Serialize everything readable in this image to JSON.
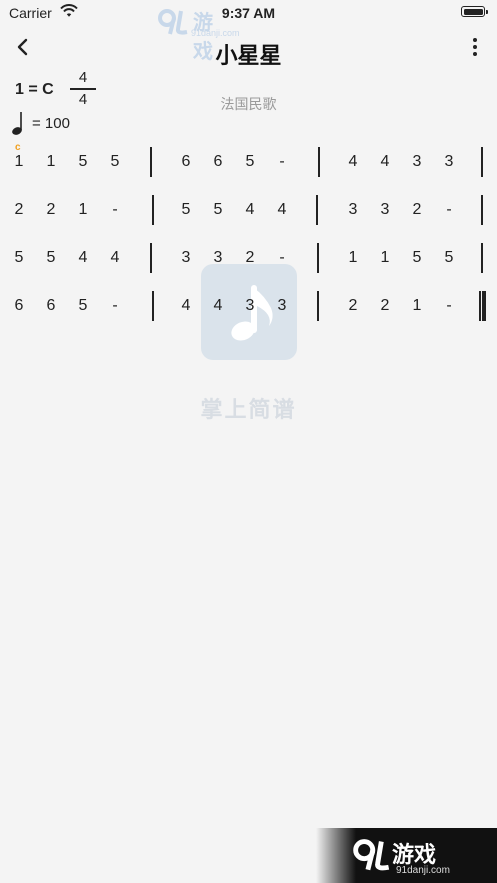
{
  "status_bar": {
    "carrier": "Carrier",
    "time": "9:37 AM"
  },
  "header": {
    "title": "小星星"
  },
  "song": {
    "key": "1 = C",
    "time_signature": {
      "top": "4",
      "bottom": "4"
    },
    "composer": "法国民歌",
    "tempo": "= 100",
    "chord_marker": "c"
  },
  "score": {
    "rows": [
      {
        "measures": [
          [
            "1",
            "1",
            "5",
            "5"
          ],
          [
            "6",
            "6",
            "5",
            "-"
          ],
          [
            "4",
            "4",
            "3",
            "3"
          ]
        ],
        "final": false
      },
      {
        "measures": [
          [
            "2",
            "2",
            "1",
            "-"
          ],
          [
            "5",
            "5",
            "4",
            "4"
          ],
          [
            "3",
            "3",
            "2",
            "-"
          ]
        ],
        "final": false
      },
      {
        "measures": [
          [
            "5",
            "5",
            "4",
            "4"
          ],
          [
            "3",
            "3",
            "2",
            "-"
          ],
          [
            "1",
            "1",
            "5",
            "5"
          ]
        ],
        "final": false
      },
      {
        "measures": [
          [
            "6",
            "6",
            "5",
            "-"
          ],
          [
            "4",
            "4",
            "3",
            "3"
          ],
          [
            "2",
            "2",
            "1",
            "-"
          ]
        ],
        "final": true
      }
    ]
  },
  "watermarks": {
    "top_logo": "游戏",
    "top_sub": "91danji.com",
    "center_label": "掌上简谱",
    "bottom_logo": "游戏",
    "bottom_sub": "91danji.com"
  },
  "icons": {
    "back": "chevron-left-icon",
    "more": "vertical-ellipsis-icon",
    "tempo": "quarter-note-icon",
    "wifi": "wifi-icon",
    "battery": "battery-icon",
    "app_logo": "music-note-icon"
  }
}
